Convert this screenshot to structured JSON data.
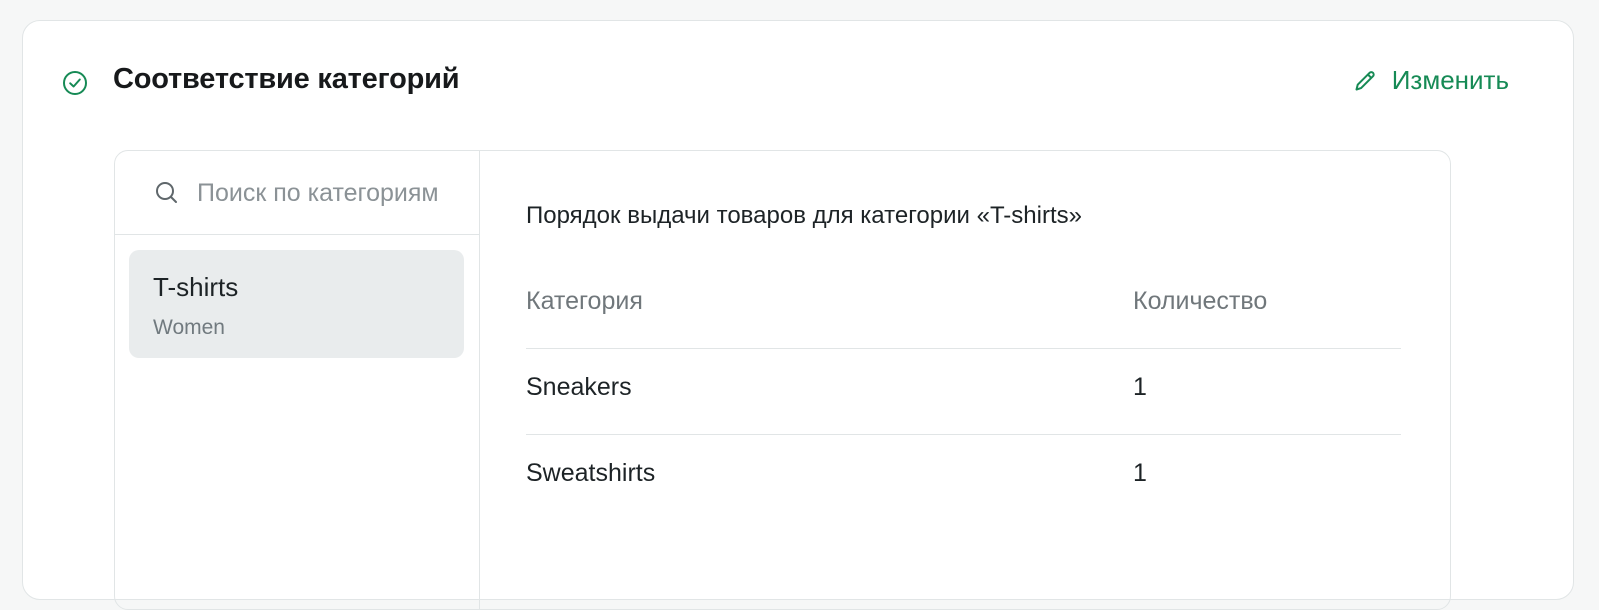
{
  "header": {
    "title": "Соответствие категорий",
    "edit_label": "Изменить",
    "status_icon": "check-circle-icon",
    "edit_icon": "pencil-icon"
  },
  "colors": {
    "accent": "#168a55",
    "selected_item_bg": "#e9eced",
    "border": "#e1e5e6"
  },
  "search": {
    "placeholder": "Поиск по категориям",
    "value": "",
    "icon": "search-icon"
  },
  "category_list": {
    "items": [
      {
        "name": "T-shirts",
        "parent": "Women",
        "selected": true
      }
    ]
  },
  "details": {
    "title": "Порядок выдачи товаров для категории «T-shirts»",
    "columns": {
      "category": "Категория",
      "count": "Количество"
    },
    "rows": [
      {
        "category": "Sneakers",
        "count": "1"
      },
      {
        "category": "Sweatshirts",
        "count": "1"
      }
    ]
  }
}
